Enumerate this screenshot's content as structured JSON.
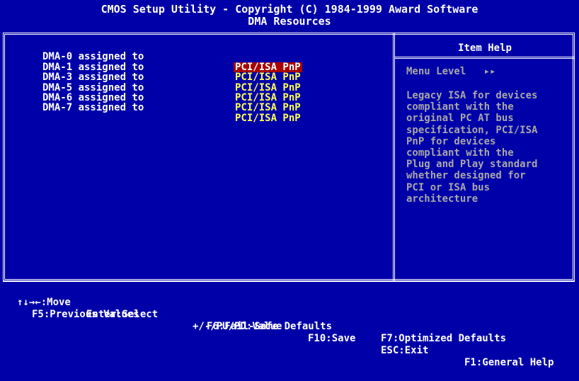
{
  "header": {
    "title_line1": "CMOS Setup Utility - Copyright (C) 1984-1999 Award Software",
    "title_line2": "DMA Resources"
  },
  "settings": [
    {
      "label": "DMA-0 assigned to",
      "value": "PCI/ISA PnP",
      "selected": true
    },
    {
      "label": "DMA-1 assigned to",
      "value": "PCI/ISA PnP",
      "selected": false
    },
    {
      "label": "DMA-3 assigned to",
      "value": "PCI/ISA PnP",
      "selected": false
    },
    {
      "label": "DMA-5 assigned to",
      "value": "PCI/ISA PnP",
      "selected": false
    },
    {
      "label": "DMA-6 assigned to",
      "value": "PCI/ISA PnP",
      "selected": false
    },
    {
      "label": "DMA-7 assigned to",
      "value": "PCI/ISA PnP",
      "selected": false
    }
  ],
  "help": {
    "title": "Item Help",
    "menu_level": "Menu Level   ▸▸",
    "text": "Legacy ISA for devices\ncompliant with the\noriginal PC AT bus\nspecification, PCI/ISA\nPnP for devices\ncompliant with the\nPlug and Play standard\nwhether designed for\nPCI or ISA bus\narchitecture"
  },
  "footer": {
    "move": "↑↓→←:Move",
    "enter": "Enter:Select",
    "value": "+/-/PU/PD:Value",
    "f10": "F10:Save",
    "esc": "ESC:Exit",
    "f1": "F1:General Help",
    "f5": "F5:Previous Values",
    "f6": "F6:Fail-Safe Defaults",
    "f7": "F7:Optimized Defaults"
  },
  "colors": {
    "background": "#0000a8",
    "value_text": "#ffff55",
    "selection": "#a80000",
    "help_text": "#a8a8a8"
  }
}
